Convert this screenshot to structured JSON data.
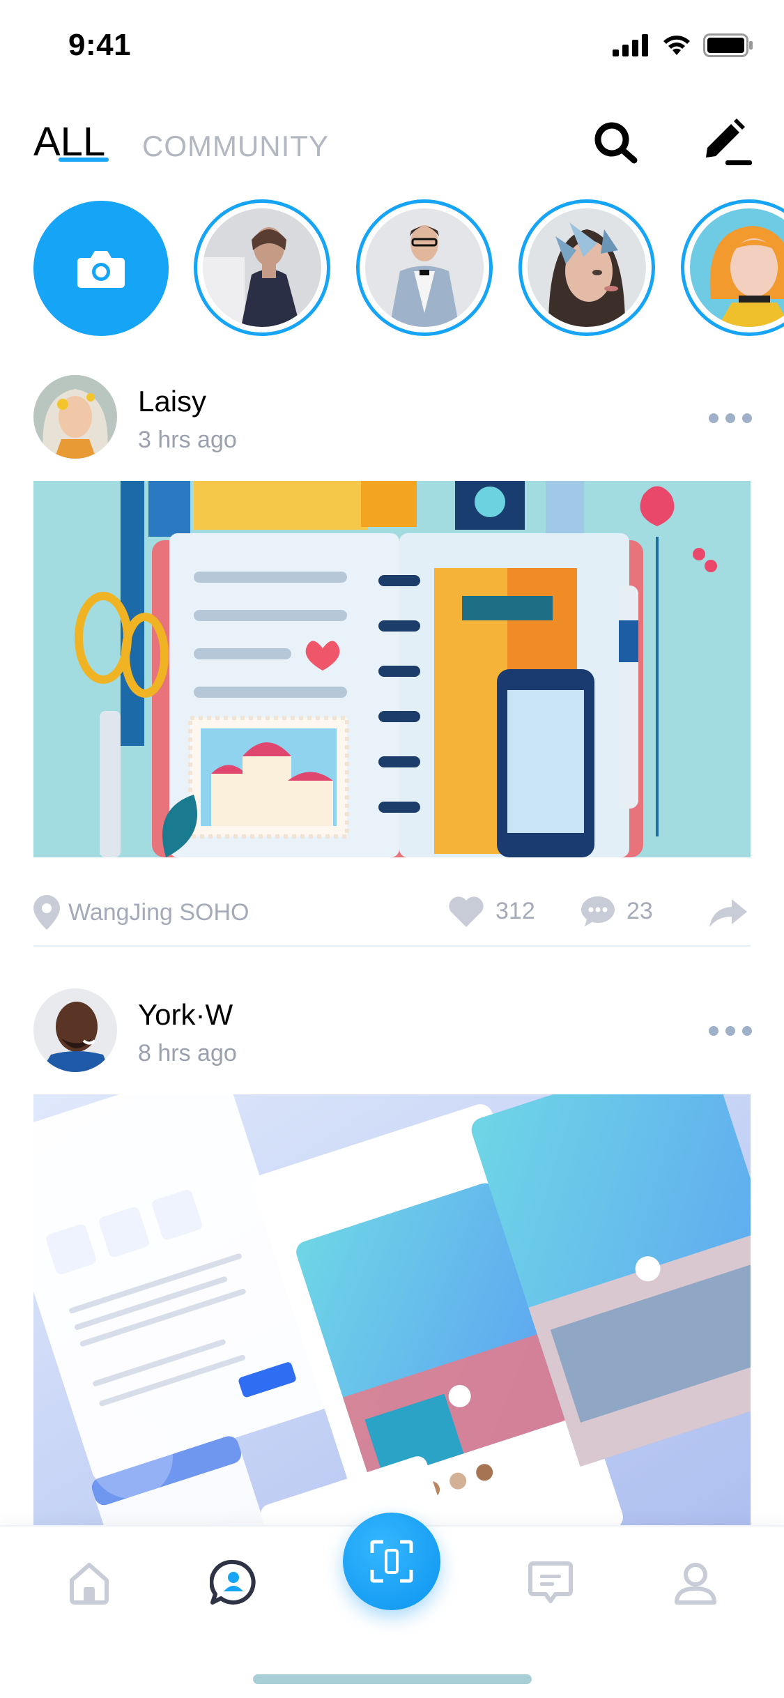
{
  "status_bar": {
    "time": "9:41"
  },
  "header": {
    "tabs": [
      {
        "label": "ALL",
        "active": true
      },
      {
        "label": "COMMUNITY",
        "active": false
      }
    ],
    "icons": [
      "search-icon",
      "edit-icon"
    ]
  },
  "stories": {
    "camera_icon": "camera-icon",
    "items": [
      {
        "name": "story-1"
      },
      {
        "name": "story-2"
      },
      {
        "name": "story-3"
      },
      {
        "name": "story-4"
      }
    ]
  },
  "posts": [
    {
      "author": "Laisy",
      "time": "3 hrs ago",
      "location": "WangJing SOHO",
      "likes": "312",
      "comments": "23"
    },
    {
      "author": "York·W",
      "time": "8 hrs ago"
    }
  ],
  "tabbar": {
    "items": [
      "home-icon",
      "community-icon",
      "scan-icon",
      "messages-icon",
      "profile-icon"
    ],
    "active": "community-icon"
  },
  "colors": {
    "accent": "#16a4f6",
    "muted_text": "#a4aab8",
    "icon_gray": "#c7ccd6"
  }
}
